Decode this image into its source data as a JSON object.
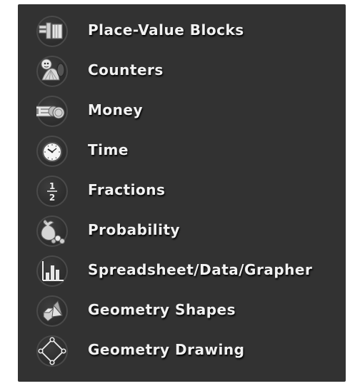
{
  "menu": {
    "items": [
      {
        "label": "Place-Value Blocks",
        "icon": "place-value-blocks-icon"
      },
      {
        "label": "Counters",
        "icon": "counters-icon"
      },
      {
        "label": "Money",
        "icon": "money-icon"
      },
      {
        "label": "Time",
        "icon": "clock-icon"
      },
      {
        "label": "Fractions",
        "icon": "fraction-icon",
        "icon_text": {
          "numerator": "1",
          "denominator": "2"
        }
      },
      {
        "label": "Probability",
        "icon": "probability-icon"
      },
      {
        "label": "Spreadsheet/Data/Grapher",
        "icon": "bar-graph-icon"
      },
      {
        "label": "Geometry Shapes",
        "icon": "geometry-shapes-icon"
      },
      {
        "label": "Geometry Drawing",
        "icon": "geometry-drawing-icon"
      }
    ]
  },
  "colors": {
    "panel_background": "#323232",
    "label_text": "#f2f2f2",
    "icon_ring": "#4a4a4a"
  }
}
